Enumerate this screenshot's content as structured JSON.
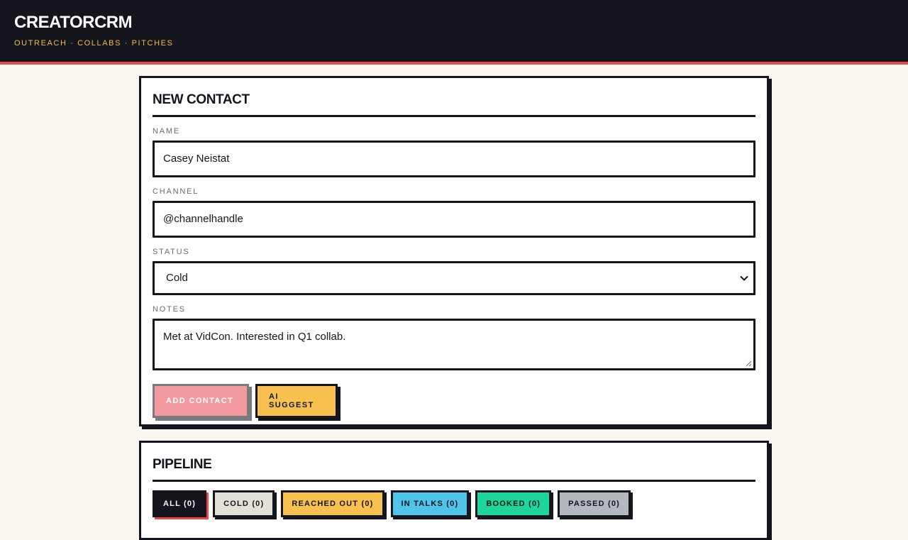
{
  "header": {
    "brand": "CREATORCRM",
    "tagline": "OUTREACH · COLLABS · PITCHES"
  },
  "form": {
    "title": "NEW CONTACT",
    "name_label": "NAME",
    "name_value": "Casey Neistat",
    "channel_label": "CHANNEL",
    "channel_value": "@channelhandle",
    "status_label": "STATUS",
    "status_value": "Cold",
    "notes_label": "NOTES",
    "notes_value": "Met at VidCon. Interested in Q1 collab.",
    "add_label": "ADD CONTACT",
    "ai_label": "AI SUGGEST"
  },
  "pipeline": {
    "title": "PIPELINE",
    "filters": [
      {
        "label": "ALL (0)"
      },
      {
        "label": "COLD (0)"
      },
      {
        "label": "REACHED OUT (0)"
      },
      {
        "label": "IN TALKS (0)"
      },
      {
        "label": "BOOKED (0)"
      },
      {
        "label": "PASSED (0)"
      }
    ]
  },
  "colors": {
    "ink": "#15151e",
    "accent_red": "#e5484d",
    "accent_yellow": "#f8c14f",
    "cyan": "#4fc3e8",
    "green": "#1ed69a"
  }
}
